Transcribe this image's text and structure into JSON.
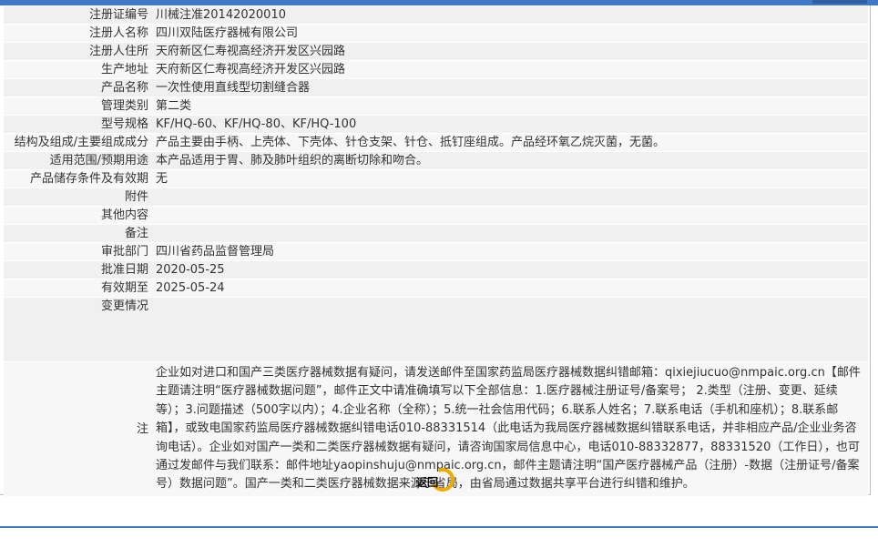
{
  "rows": [
    {
      "label": "注册证编号",
      "value": "川械注准20142020010"
    },
    {
      "label": "注册人名称",
      "value": "四川双陆医疗器械有限公司"
    },
    {
      "label": "注册人住所",
      "value": "天府新区仁寿视高经济开发区兴园路"
    },
    {
      "label": "生产地址",
      "value": "天府新区仁寿视高经济开发区兴园路"
    },
    {
      "label": "产品名称",
      "value": "一次性使用直线型切割缝合器"
    },
    {
      "label": "管理类别",
      "value": "第二类"
    },
    {
      "label": "型号规格",
      "value": "KF/HQ-60、KF/HQ-80、KF/HQ-100"
    },
    {
      "label": "结构及组成/主要组成成分",
      "value": "产品主要由手柄、上壳体、下壳体、针仓支架、针仓、抵钉座组成。产品经环氧乙烷灭菌，无菌。"
    },
    {
      "label": "适用范围/预期用途",
      "value": "本产品适用于胃、肺及肺叶组织的离断切除和吻合。"
    },
    {
      "label": "产品储存条件及有效期",
      "value": "无"
    },
    {
      "label": "附件",
      "value": ""
    },
    {
      "label": "其他内容",
      "value": ""
    },
    {
      "label": "备注",
      "value": ""
    },
    {
      "label": "审批部门",
      "value": "四川省药品监督管理局"
    },
    {
      "label": "批准日期",
      "value": "2020-05-25"
    },
    {
      "label": "有效期至",
      "value": "2025-05-24"
    }
  ],
  "change": {
    "label": "变更情况",
    "value": ""
  },
  "note": {
    "label": "注",
    "text": "企业如对进口和国产三类医疗器械数据有疑问，请发送邮件至国家药监局医疗器械数据纠错邮箱：qixiejiucuo@nmpaic.org.cn【邮件主题请注明“医疗器械数据问题”，邮件正文中请准确填写以下全部信息：1.医疗器械注册证号/备案号； 2.类型（注册、变更、延续等）；3.问题描述（500字以内）；4.企业名称（全称）；5.统一社会信用代码；6.联系人姓名；7.联系电话（手机和座机）；8.联系邮箱】，或致电国家药监局医疗器械数据纠错电话010-88331514（此电话为我局医疗器械数据纠错联系电话，并非相应产品/企业业务咨询电话）。企业如对国产一类和二类医疗器械数据有疑问，请咨询国家局信息中心，电话010-88332877，88331520（工作日），也可通过发邮件与我们联系：邮件地址yaopinshuju@nmpaic.org.cn，邮件主题请注明“国产医疗器械产品（注册）-数据（注册证号/备案号）数据问题”。国产一类和二类医疗器械数据来源于省局，由省局通过数据共享平台进行纠错和维护。"
  },
  "back_button": {
    "label": "返回",
    "icon": "return-ring-icon",
    "accent": "#f2a900"
  },
  "colors": {
    "brand": "#3f78c4",
    "row_odd": "#f0f0f0",
    "row_even": "#f7f7f7"
  }
}
